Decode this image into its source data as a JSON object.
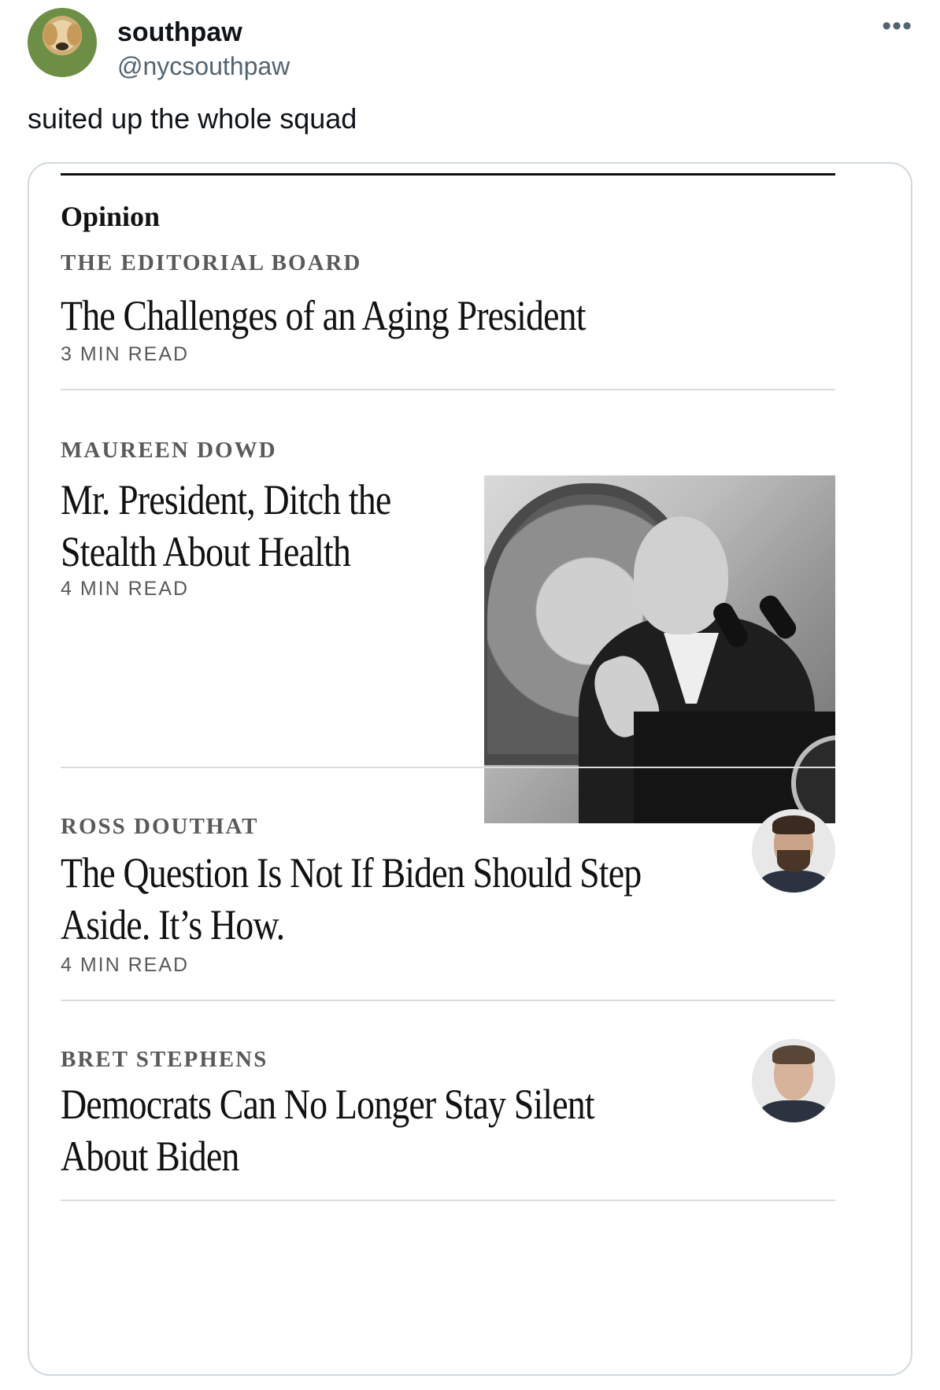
{
  "tweet": {
    "display_name": "southpaw",
    "handle": "@nycsouthpaw",
    "more_glyph": "•••",
    "text": "suited up the whole squad"
  },
  "card": {
    "section": "Opinion",
    "articles": [
      {
        "byline": "THE EDITORIAL BOARD",
        "headline": "The Challenges of an Aging President",
        "read_time": "3 MIN READ"
      },
      {
        "byline": "MAUREEN DOWD",
        "headline_lines": [
          "Mr. President, Ditch the",
          "Stealth About Health"
        ],
        "read_time": "4 MIN READ"
      },
      {
        "byline": "ROSS DOUTHAT",
        "headline_lines": [
          "The Question Is Not If Biden Should Step",
          "Aside. It’s How."
        ],
        "read_time": "4 MIN READ"
      },
      {
        "byline": "BRET STEPHENS",
        "headline_lines": [
          "Democrats Can No Longer Stay Silent",
          "About Biden"
        ]
      }
    ]
  },
  "icons": {
    "avatar": "golden-retriever-puppy-avatar",
    "more": "more-options-icon"
  }
}
